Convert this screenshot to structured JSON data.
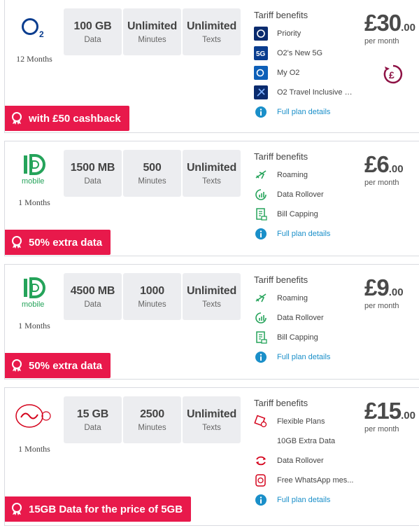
{
  "deals": [
    {
      "provider": "O2",
      "term": "12 Months",
      "stats": [
        {
          "value": "100 GB",
          "label": "Data"
        },
        {
          "value": "Unlimited",
          "label": "Minutes"
        },
        {
          "value": "Unlimited",
          "label": "Texts"
        }
      ],
      "benefits_title": "Tariff benefits",
      "benefits": [
        {
          "icon": "o2-priority-icon",
          "text": "Priority"
        },
        {
          "icon": "5g-icon",
          "text": "O2's New 5G"
        },
        {
          "icon": "my-o2-icon",
          "text": "My O2"
        },
        {
          "icon": "travel-icon",
          "text": "O2 Travel Inclusive Z..."
        }
      ],
      "plan_details": "Full plan details",
      "price_pounds": "£30",
      "price_pence": ".00",
      "price_period": "per month",
      "promo": "with £50 cashback"
    },
    {
      "provider": "iD mobile",
      "term": "1 Months",
      "stats": [
        {
          "value": "1500 MB",
          "label": "Data"
        },
        {
          "value": "500",
          "label": "Minutes"
        },
        {
          "value": "Unlimited",
          "label": "Texts"
        }
      ],
      "benefits_title": "Tariff benefits",
      "benefits": [
        {
          "icon": "plane-icon",
          "text": "Roaming"
        },
        {
          "icon": "data-rollover-icon",
          "text": "Data Rollover"
        },
        {
          "icon": "bill-capping-icon",
          "text": "Bill Capping"
        }
      ],
      "plan_details": "Full plan details",
      "price_pounds": "£6",
      "price_pence": ".00",
      "price_period": "per month",
      "promo": "50% extra data"
    },
    {
      "provider": "iD mobile",
      "term": "1 Months",
      "stats": [
        {
          "value": "4500 MB",
          "label": "Data"
        },
        {
          "value": "1000",
          "label": "Minutes"
        },
        {
          "value": "Unlimited",
          "label": "Texts"
        }
      ],
      "benefits_title": "Tariff benefits",
      "benefits": [
        {
          "icon": "plane-icon",
          "text": "Roaming"
        },
        {
          "icon": "data-rollover-icon",
          "text": "Data Rollover"
        },
        {
          "icon": "bill-capping-icon",
          "text": "Bill Capping"
        }
      ],
      "plan_details": "Full plan details",
      "price_pounds": "£9",
      "price_pence": ".00",
      "price_period": "per month",
      "promo": "50% extra data"
    },
    {
      "provider": "Virgin Media",
      "term": "1 Months",
      "stats": [
        {
          "value": "15 GB",
          "label": "Data"
        },
        {
          "value": "2500",
          "label": "Minutes"
        },
        {
          "value": "Unlimited",
          "label": "Texts"
        }
      ],
      "benefits_title": "Tariff benefits",
      "benefits": [
        {
          "icon": "flexible-plans-icon",
          "text": "Flexible Plans"
        },
        {
          "icon": "none",
          "text": "10GB Extra Data"
        },
        {
          "icon": "data-rollover-icon",
          "text": "Data Rollover"
        },
        {
          "icon": "whatsapp-icon",
          "text": "Free WhatsApp mes..."
        }
      ],
      "plan_details": "Full plan details",
      "price_pounds": "£15",
      "price_pence": ".00",
      "price_period": "per month",
      "promo": "15GB Data for the price of 5GB"
    }
  ],
  "colors": {
    "promo_bg": "#e8194b",
    "link": "#1a8fc9",
    "id_green": "#25a35a",
    "o2_blue": "#0a3d8f",
    "virgin_red": "#d4001a"
  }
}
